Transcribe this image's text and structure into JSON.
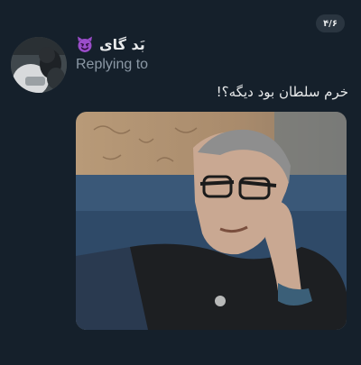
{
  "pager": {
    "label": "۴/۶"
  },
  "tweet": {
    "display_name": "بَد گای",
    "name_emoji_icon": "smiling-devil-icon",
    "replying_label": "Replying to",
    "text": "خرم سلطان بود دیگه؟!"
  },
  "colors": {
    "background": "#15202b",
    "primary_text": "#e7e9ea",
    "secondary_text": "#8b98a5",
    "devil_purple": "#9b4dca"
  }
}
